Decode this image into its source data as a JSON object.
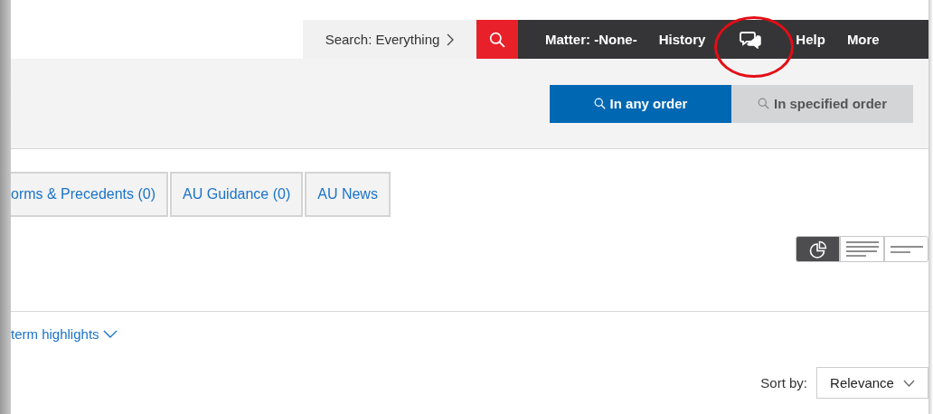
{
  "header": {
    "search_scope": "Search: Everything",
    "nav": [
      {
        "kind": "text",
        "label": "Matter: -None-"
      },
      {
        "kind": "text",
        "label": "History"
      },
      {
        "kind": "chat",
        "highlighted": true
      },
      {
        "kind": "text",
        "label": "Help"
      },
      {
        "kind": "text",
        "label": "More"
      }
    ]
  },
  "order_toggle": [
    {
      "label": "In any order",
      "selected": true
    },
    {
      "label": "In specified order",
      "selected": false
    }
  ],
  "tabs": [
    {
      "label": "orms & Precedents (0)",
      "selected": false
    },
    {
      "label": "AU Guidance (0)",
      "selected": false
    },
    {
      "label": "AU News",
      "selected": false
    }
  ],
  "view_modes": [
    {
      "kind": "chart",
      "selected": true
    },
    {
      "kind": "full",
      "selected": false
    },
    {
      "kind": "brief",
      "selected": false
    }
  ],
  "highlights_link": "term highlights",
  "sort": {
    "label": "Sort by:",
    "value": "Relevance"
  }
}
